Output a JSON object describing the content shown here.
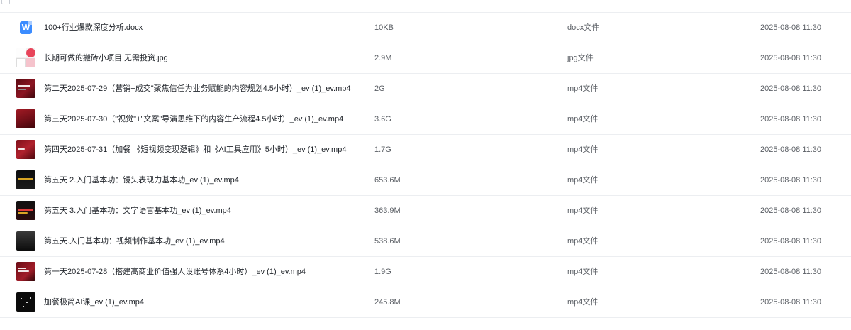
{
  "files": [
    {
      "name": "100+行业爆款深度分析.docx",
      "size": "10KB",
      "type": "docx文件",
      "time": "2025-08-08 11:30",
      "thumb": "doc-icon"
    },
    {
      "name": "长期可做的搬砖小项目 无需投资.jpg",
      "size": "2.9M",
      "type": "jpg文件",
      "time": "2025-08-08 11:30",
      "thumb": "image-thumbnail"
    },
    {
      "name": "第二天2025-07-29（营销+成交\"聚焦信任为业务赋能的内容规划4.5小时）_ev (1)_ev.mp4",
      "size": "2G",
      "type": "mp4文件",
      "time": "2025-08-08 11:30",
      "thumb": "video-thumbnail"
    },
    {
      "name": "第三天2025-07-30（\"视觉\"+\"文案\"导演思维下的内容生产流程4.5小时）_ev (1)_ev.mp4",
      "size": "3.6G",
      "type": "mp4文件",
      "time": "2025-08-08 11:30",
      "thumb": "video-thumbnail"
    },
    {
      "name": "第四天2025-07-31（加餐 《短视频变现逻辑》和《AI工具应用》5小时）_ev (1)_ev.mp4",
      "size": "1.7G",
      "type": "mp4文件",
      "time": "2025-08-08 11:30",
      "thumb": "video-thumbnail"
    },
    {
      "name": "第五天 2.入门基本功：镜头表现力基本功_ev (1)_ev.mp4",
      "size": "653.6M",
      "type": "mp4文件",
      "time": "2025-08-08 11:30",
      "thumb": "video-thumbnail"
    },
    {
      "name": "第五天 3.入门基本功：文字语言基本功_ev (1)_ev.mp4",
      "size": "363.9M",
      "type": "mp4文件",
      "time": "2025-08-08 11:30",
      "thumb": "video-thumbnail"
    },
    {
      "name": "第五天.入门基本功：视频制作基本功_ev (1)_ev.mp4",
      "size": "538.6M",
      "type": "mp4文件",
      "time": "2025-08-08 11:30",
      "thumb": "video-thumbnail"
    },
    {
      "name": "第一天2025-07-28（搭建高商业价值强人设账号体系4小时）_ev (1)_ev.mp4",
      "size": "1.9G",
      "type": "mp4文件",
      "time": "2025-08-08 11:30",
      "thumb": "video-thumbnail"
    },
    {
      "name": "加餐极简AI课_ev (1)_ev.mp4",
      "size": "245.8M",
      "type": "mp4文件",
      "time": "2025-08-08 11:30",
      "thumb": "video-thumbnail"
    }
  ],
  "icons": {
    "doc_letter": "W",
    "doc_color": "#3b8cff"
  }
}
